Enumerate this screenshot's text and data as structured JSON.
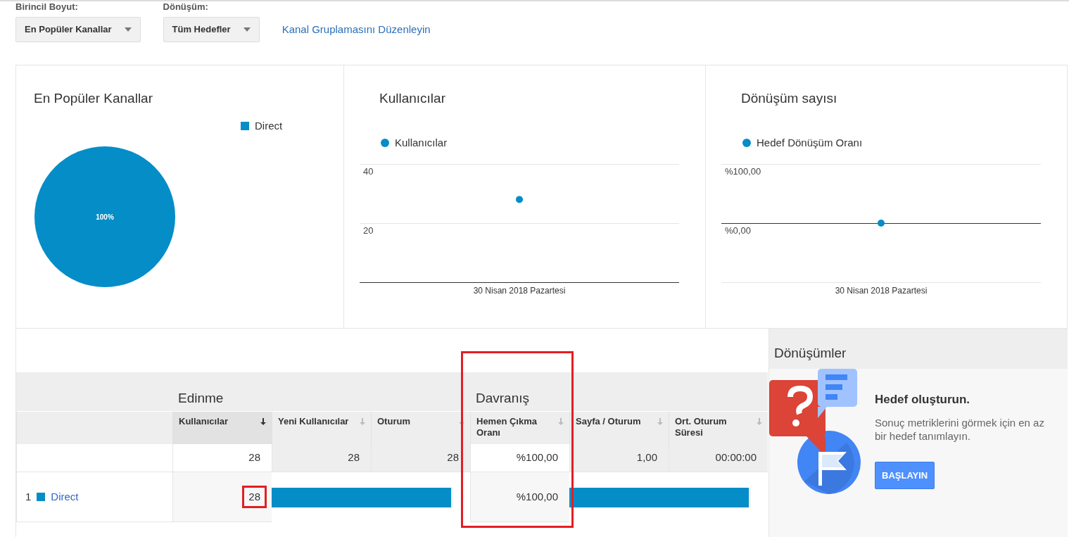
{
  "filters": [
    {
      "label": "Birincil Boyut:",
      "value": "En Popüler Kanallar"
    },
    {
      "label": "Dönüşüm:",
      "value": "Tüm Hedefler"
    }
  ],
  "edit_link": "Kanal Gruplamasını Düzenleyin",
  "panels": [
    {
      "title": "En Popüler Kanallar",
      "chart_data": {
        "type": "pie",
        "categories": [
          "Direct"
        ],
        "values": [
          100
        ],
        "value_labels": [
          "100%"
        ]
      }
    },
    {
      "title": "Kullanıcılar",
      "chart_data": {
        "type": "line",
        "x": [
          "30 Nisan 2018 Pazartesi"
        ],
        "series": [
          {
            "name": "Kullanıcılar",
            "color": "#058dc7",
            "marker": true,
            "values": [
              28
            ]
          }
        ],
        "ylim": [
          0,
          40
        ],
        "yticks": [
          20,
          40
        ]
      }
    },
    {
      "title": "Dönüşüm sayısı",
      "chart_data": {
        "type": "line",
        "x": [
          "30 Nisan 2018 Pazartesi"
        ],
        "series": [
          {
            "name": "Hedef Dönüşüm Oranı",
            "color": "#058dc7",
            "marker": true,
            "values": [
              0
            ]
          }
        ],
        "ylim": [
          -100,
          100
        ],
        "yticks": [
          {
            "value": 0,
            "label": "%0,00"
          },
          {
            "value": 100,
            "label": "%100,00"
          }
        ]
      }
    }
  ],
  "table": {
    "groups": [
      {
        "title": "Edinme",
        "highlighted": false
      },
      {
        "title": "Davranış",
        "highlighted": true
      }
    ],
    "columns": [
      {
        "label": "Kullanıcılar",
        "sorted": true,
        "total": "28"
      },
      {
        "label": "Yeni Kullanıcılar",
        "sorted": false,
        "total": "28"
      },
      {
        "label": "Oturum",
        "sorted": false,
        "total": "28"
      },
      {
        "label": "Hemen Çıkma Oranı",
        "sorted": false,
        "total": "%100,00"
      },
      {
        "label": "Sayfa / Oturum",
        "sorted": false,
        "total": "1,00"
      },
      {
        "label": "Ort. Oturum Süresi",
        "sorted": false,
        "total": "00:00:00"
      }
    ],
    "rows": [
      {
        "index": "1",
        "color": "#058dc7",
        "name": "Direct",
        "acquisition": {
          "value": "28",
          "highlighted": true,
          "level": 1
        },
        "behavior": {
          "value": "%100,00",
          "highlighted": false,
          "level": 1
        }
      }
    ]
  },
  "conversions": {
    "title": "Dönüşümler",
    "heading": "Hedef oluşturun.",
    "text": "Sonuç metriklerini görmek için en az bir hedef tanımlayın.",
    "button": "BAŞLAYIN"
  }
}
